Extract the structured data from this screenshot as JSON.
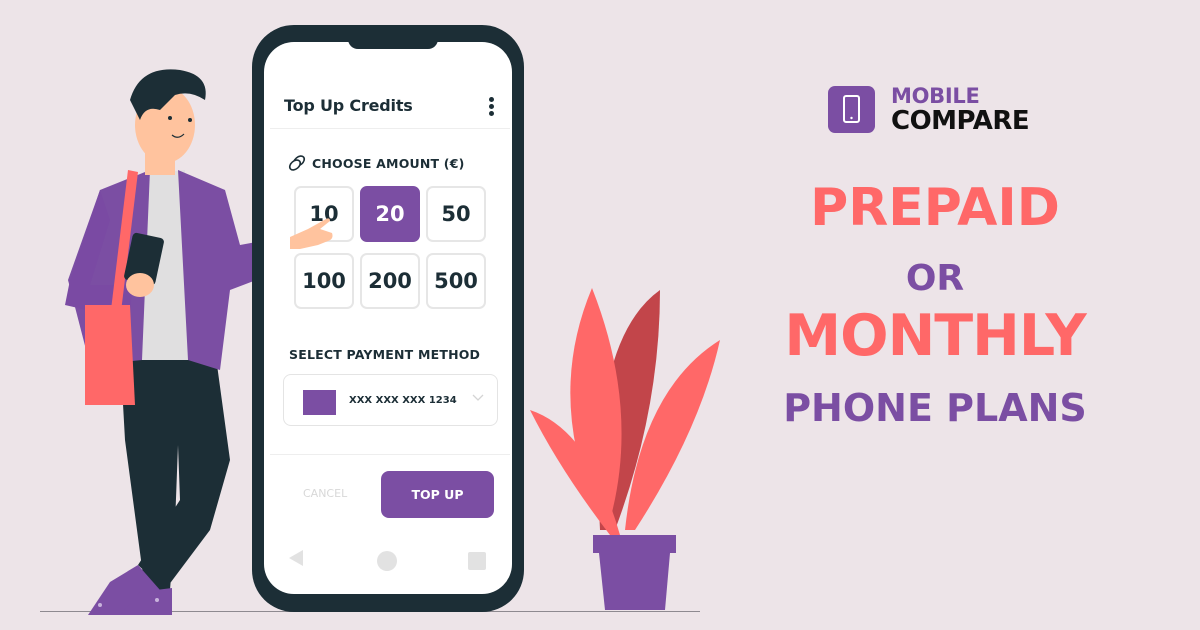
{
  "brand": {
    "line1": "MOBILE",
    "line2": "COMPARE",
    "icon": "smartphone-icon",
    "colors": {
      "purple": "#7b4ea3",
      "coral": "#ff6868",
      "dark": "#1c2e36",
      "background": "#ede4e8"
    }
  },
  "headline": {
    "word1": "PREPAID",
    "word2": "OR",
    "word3": "MONTHLY",
    "word4": "PHONE PLANS"
  },
  "phone_app": {
    "title": "Top Up Credits",
    "menu_icon": "kebab-menu-icon",
    "amount_section": {
      "icon": "coins-icon",
      "label": "CHOOSE AMOUNT (€)",
      "options": [
        "10",
        "20",
        "50",
        "100",
        "200",
        "500"
      ],
      "selected": "20"
    },
    "payment_section": {
      "label": "SELECT PAYMENT METHOD",
      "card_number": "XXX XXX XXX 1234",
      "dropdown_icon": "chevron-down-icon"
    },
    "actions": {
      "cancel": "CANCEL",
      "confirm": "TOP UP"
    },
    "nav_bar": [
      "back-icon",
      "home-icon",
      "recents-icon"
    ]
  }
}
